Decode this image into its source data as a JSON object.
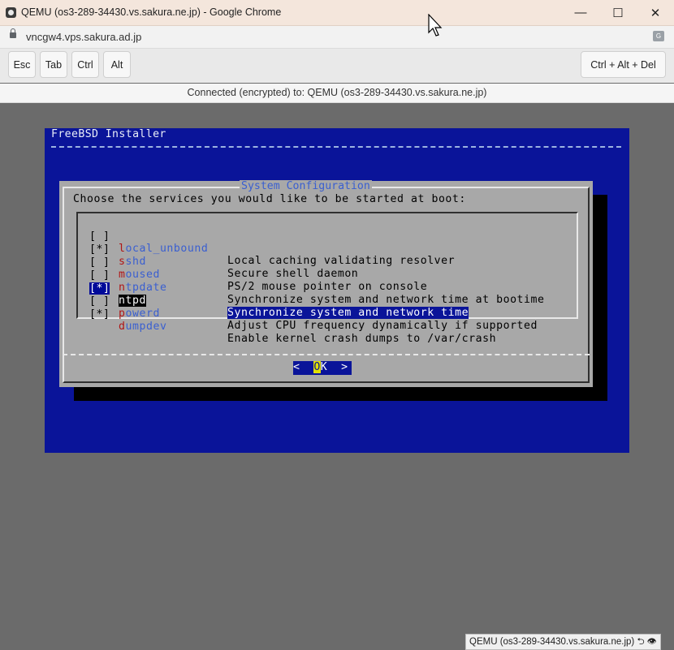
{
  "window": {
    "title": "QEMU (os3-289-34430.vs.sakura.ne.jp) - Google Chrome",
    "minimize": "—",
    "maximize": "☐",
    "close": "✕"
  },
  "address": {
    "url": "vncgw4.vps.sakura.ad.jp"
  },
  "toolbar": {
    "esc": "Esc",
    "tab": "Tab",
    "ctrl": "Ctrl",
    "alt": "Alt",
    "ctrl_alt_del": "Ctrl + Alt + Del"
  },
  "status": "Connected (encrypted) to: QEMU (os3-289-34430.vs.sakura.ne.jp)",
  "installer": {
    "backtitle": "FreeBSD Installer",
    "dialog_title": "System Configuration",
    "prompt": "Choose the services you would like to be started at boot:",
    "items": [
      {
        "check": "[ ]",
        "hot": "l",
        "name": "ocal_unbound",
        "desc": "Local caching validating resolver",
        "selected": false
      },
      {
        "check": "[*]",
        "hot": "s",
        "name": "shd",
        "desc": "Secure shell daemon",
        "selected": false
      },
      {
        "check": "[ ]",
        "hot": "m",
        "name": "oused",
        "desc": "PS/2 mouse pointer on console",
        "selected": false
      },
      {
        "check": "[ ]",
        "hot": "n",
        "name": "tpdate",
        "desc": "Synchronize system and network time at bootime",
        "selected": false
      },
      {
        "check": "[*]",
        "hot": "n",
        "name": "tpd",
        "desc": "Synchronize system and network time",
        "selected": true
      },
      {
        "check": "[ ]",
        "hot": "p",
        "name": "owerd",
        "desc": "Adjust CPU frequency dynamically if supported",
        "selected": false
      },
      {
        "check": "[*]",
        "hot": "d",
        "name": "umpdev",
        "desc": "Enable kernel crash dumps to /var/crash",
        "selected": false
      }
    ],
    "ok_left": "<  ",
    "ok_hot": "O",
    "ok_rest": "K  >"
  },
  "footer_tip": "QEMU (os3-289-34430.vs.sakura.ne.jp)",
  "icons": [
    "app-icon",
    "lock-icon",
    "translate-icon",
    "cursor-icon"
  ]
}
